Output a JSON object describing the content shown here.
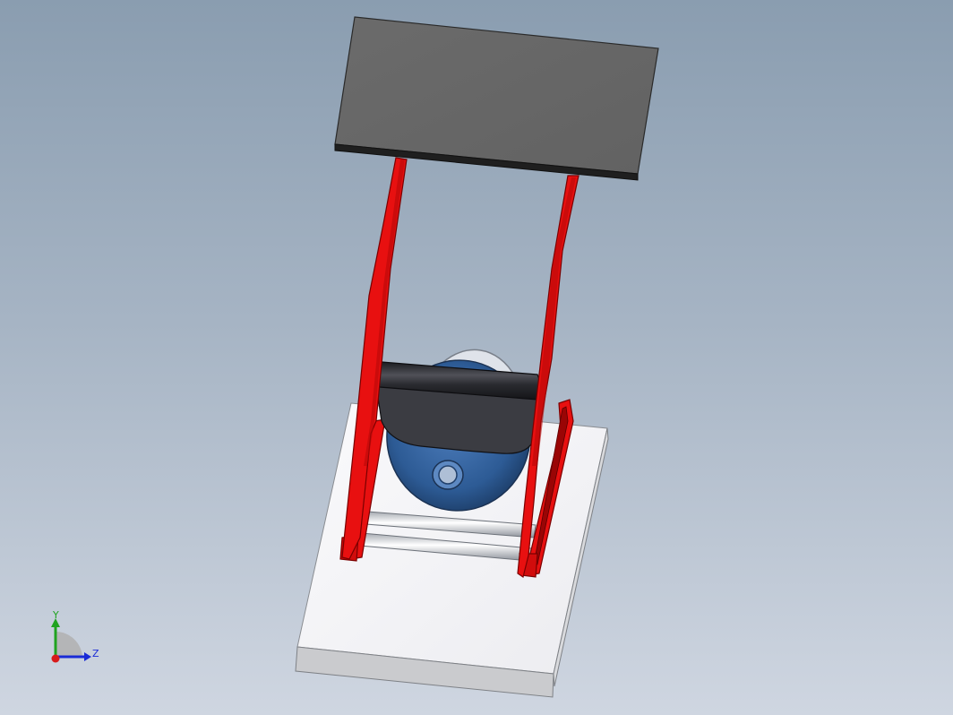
{
  "viewport": {
    "background_top": "#8a9db0",
    "background_bottom": "#cfd6e1"
  },
  "model": {
    "base_plate_color": "#f4f4f6",
    "base_plate_side_color": "#c9c9cc",
    "top_panel_color": "#676767",
    "top_panel_edge_color": "#1e1e1e",
    "frame_color": "#e81010",
    "frame_dark_color": "#8d0000",
    "cylinder_color": "#33343a",
    "wheel_color": "#2e5d96",
    "rod_color": "#e6e8ec"
  },
  "triad": {
    "y_label": "Y",
    "z_label": "Z",
    "y_color": "#1fa31f",
    "z_color": "#1a2bd6",
    "origin_color": "#d81b1b"
  }
}
